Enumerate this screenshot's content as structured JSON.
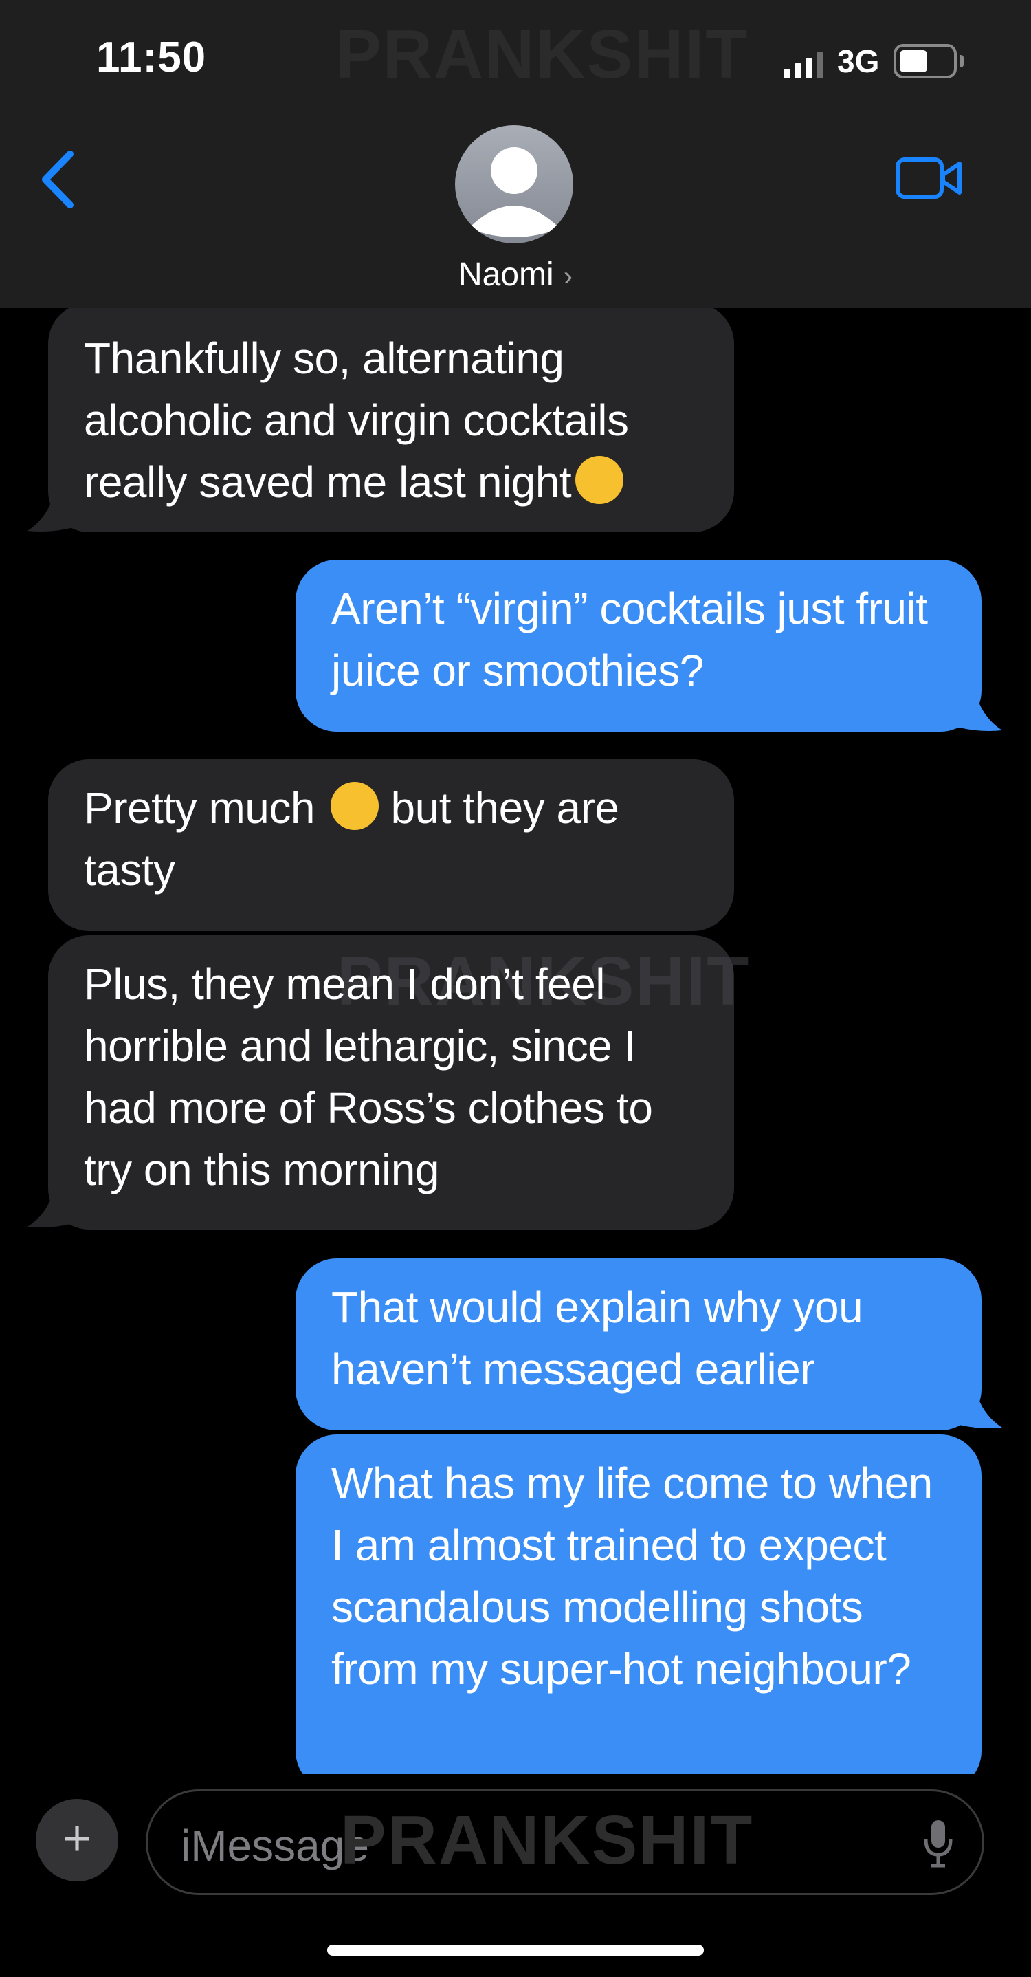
{
  "status": {
    "time": "11:50",
    "network": "3G"
  },
  "watermark": "PRANKSHIT",
  "contact": {
    "name": "Naomi",
    "chevron": "›"
  },
  "messages": [
    {
      "from": "them",
      "text": "Thankfully so, alternating alcoholic and virgin cocktails really saved me last night",
      "emoji": "face-exhaling-emoji"
    },
    {
      "from": "me",
      "text": "Aren’t “virgin” cocktails just fruit juice or smoothies?"
    },
    {
      "from": "them",
      "text_before": "Pretty much",
      "emoji": "rolling-on-floor-laughing-emoji",
      "text_after": "but they are tasty"
    },
    {
      "from": "them",
      "text": "Plus, they mean I don’t feel horrible and lethargic, since I had more of Ross’s clothes to try on this morning"
    },
    {
      "from": "me",
      "text": "That would explain why you haven’t messaged earlier"
    },
    {
      "from": "me",
      "text": "What has my life come to when I am almost trained to expect scandalous modelling shots from my super-hot neighbour?"
    }
  ],
  "composer": {
    "placeholder": "iMessage",
    "plus": "+"
  },
  "colors": {
    "incoming": "#262629",
    "outgoing": "#3a8ef6",
    "accent": "#1a84ff",
    "header": "#1f1f1f"
  }
}
